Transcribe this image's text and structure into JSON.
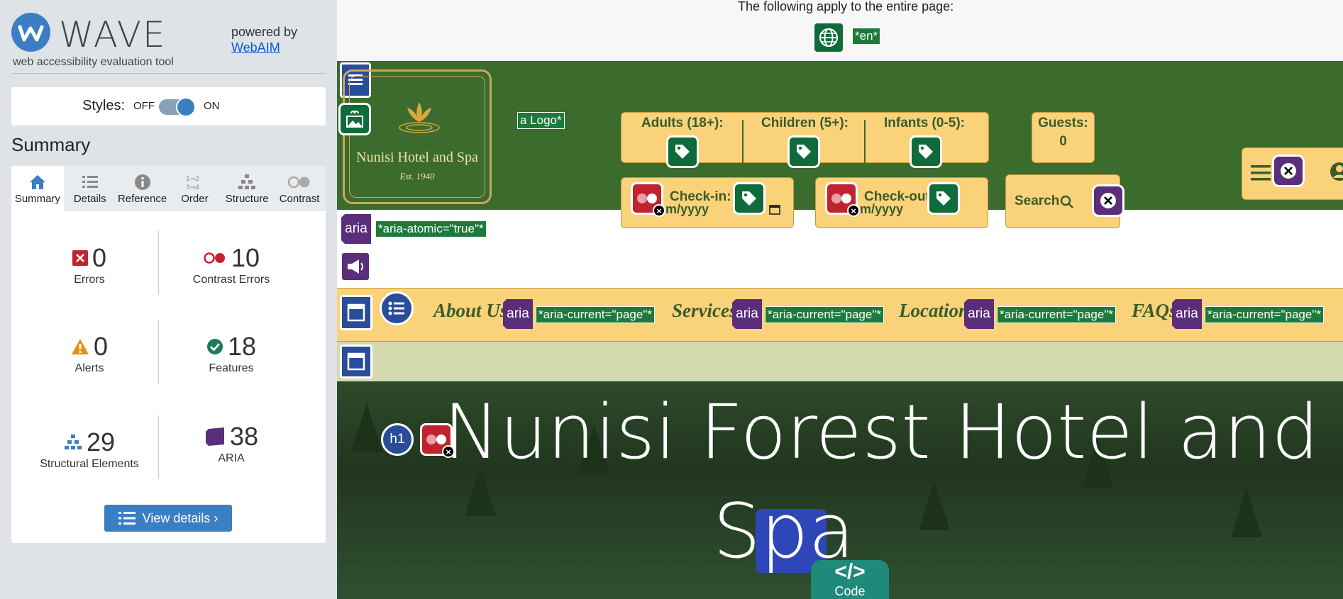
{
  "sidebar": {
    "brand": "WAVE",
    "tagline": "web accessibility evaluation tool",
    "powered_by": "powered by",
    "webaim_link": "WebAIM",
    "styles_label": "Styles:",
    "toggle_off": "OFF",
    "toggle_on": "ON",
    "summary_heading": "Summary",
    "tabs": [
      {
        "label": "Summary",
        "icon": "home-icon",
        "active": true
      },
      {
        "label": "Details",
        "icon": "list-icon"
      },
      {
        "label": "Reference",
        "icon": "info-icon"
      },
      {
        "label": "Order",
        "icon": "order-icon"
      },
      {
        "label": "Structure",
        "icon": "structure-icon"
      },
      {
        "label": "Contrast",
        "icon": "contrast-icon"
      }
    ],
    "stats": {
      "errors": {
        "value": "0",
        "label": "Errors"
      },
      "contrast": {
        "value": "10",
        "label": "Contrast Errors"
      },
      "alerts": {
        "value": "0",
        "label": "Alerts"
      },
      "features": {
        "value": "18",
        "label": "Features"
      },
      "structural": {
        "value": "29",
        "label": "Structural Elements"
      },
      "aria": {
        "value": "38",
        "label": "ARIA"
      }
    },
    "view_details": "View details ›"
  },
  "page": {
    "notice": "The following apply to the entire page:",
    "lang_tag": "*en*",
    "logo_tag": "a Logo*",
    "logo_name": "Nunisi Hotel and Spa",
    "logo_est": "Est. 1940",
    "booking": {
      "adults": "Adults (18+):",
      "children": "Children (5+):",
      "infants": "Infants (0-5):",
      "guests_label": "Guests:",
      "guests_value": "0",
      "checkin": "Check-in:",
      "checkout": "Check-out:",
      "date_placeholder": "m/yyyy",
      "search": "Search"
    },
    "aria_atomic_tag": "*aria-atomic=\"true\"*",
    "aria_chip": "aria",
    "nav": [
      {
        "label": "About Us",
        "tag": "*aria-current=\"page\"*"
      },
      {
        "label": "Services",
        "tag": "*aria-current=\"page\"*"
      },
      {
        "label": "Location",
        "tag": "*aria-current=\"page\"*"
      },
      {
        "label": "FAQs",
        "tag": "*aria-current=\"page\"*"
      }
    ],
    "hero_line1": "Nunisi Forest Hotel and",
    "hero_line2": "Spa",
    "h1_badge": "h1",
    "code_badge_symbol": "</>",
    "code_badge_label": "Code"
  },
  "colors": {
    "wave_blue": "#3b7ec4",
    "header_green": "#3b6b2d",
    "nav_gold": "#f9d27a",
    "error_red": "#c0232f",
    "feature_green": "#0f6b3a",
    "aria_purple": "#5a2e7a"
  }
}
